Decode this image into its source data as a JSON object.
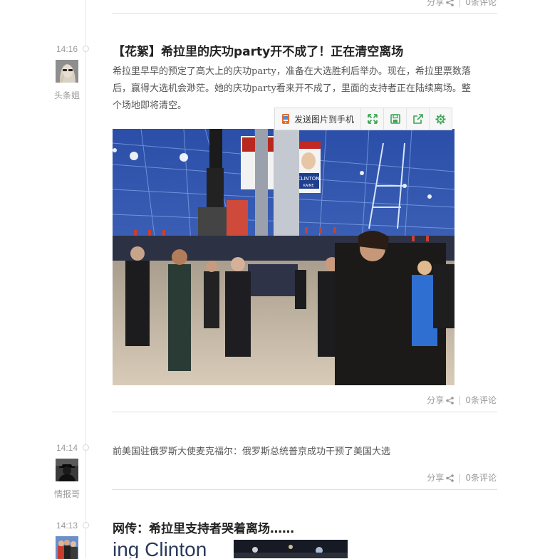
{
  "posts": [
    {
      "footer": {
        "share_label": "分享",
        "comments_label": "0条评论"
      }
    },
    {
      "time": "14:16",
      "author": "头条姐",
      "title": "【花絮】希拉里的庆功party开不成了！正在清空离场",
      "description_lines": [
        "希拉里早早的预定了高大上的庆功party，准备在大选胜利后举办。现在，希拉里票数落",
        "后，赢得大选机会渺茫。她的庆功party看来开不成了，里面的支持者正在陆续离场。整",
        "个场地即将清空。"
      ],
      "image_toolbar": {
        "send_to_phone_label": "发送图片到手机",
        "icons": [
          "expand-icon",
          "save-icon",
          "share-out-icon",
          "settings-icon"
        ],
        "accent": "#3aa655"
      },
      "image_sign": {
        "line1": "CLINTON",
        "line2": "KAINE"
      },
      "footer": {
        "share_label": "分享",
        "comments_label": "0条评论"
      }
    },
    {
      "time": "14:14",
      "author": "情报哥",
      "text": "前美国驻俄罗斯大使麦克福尔：俄罗斯总统普京成功干预了美国大选",
      "footer": {
        "share_label": "分享",
        "comments_label": "0条评论"
      }
    },
    {
      "time": "14:13",
      "title": "网传：希拉里支持者哭着离场……",
      "image_caption": "ing Clinton"
    }
  ]
}
